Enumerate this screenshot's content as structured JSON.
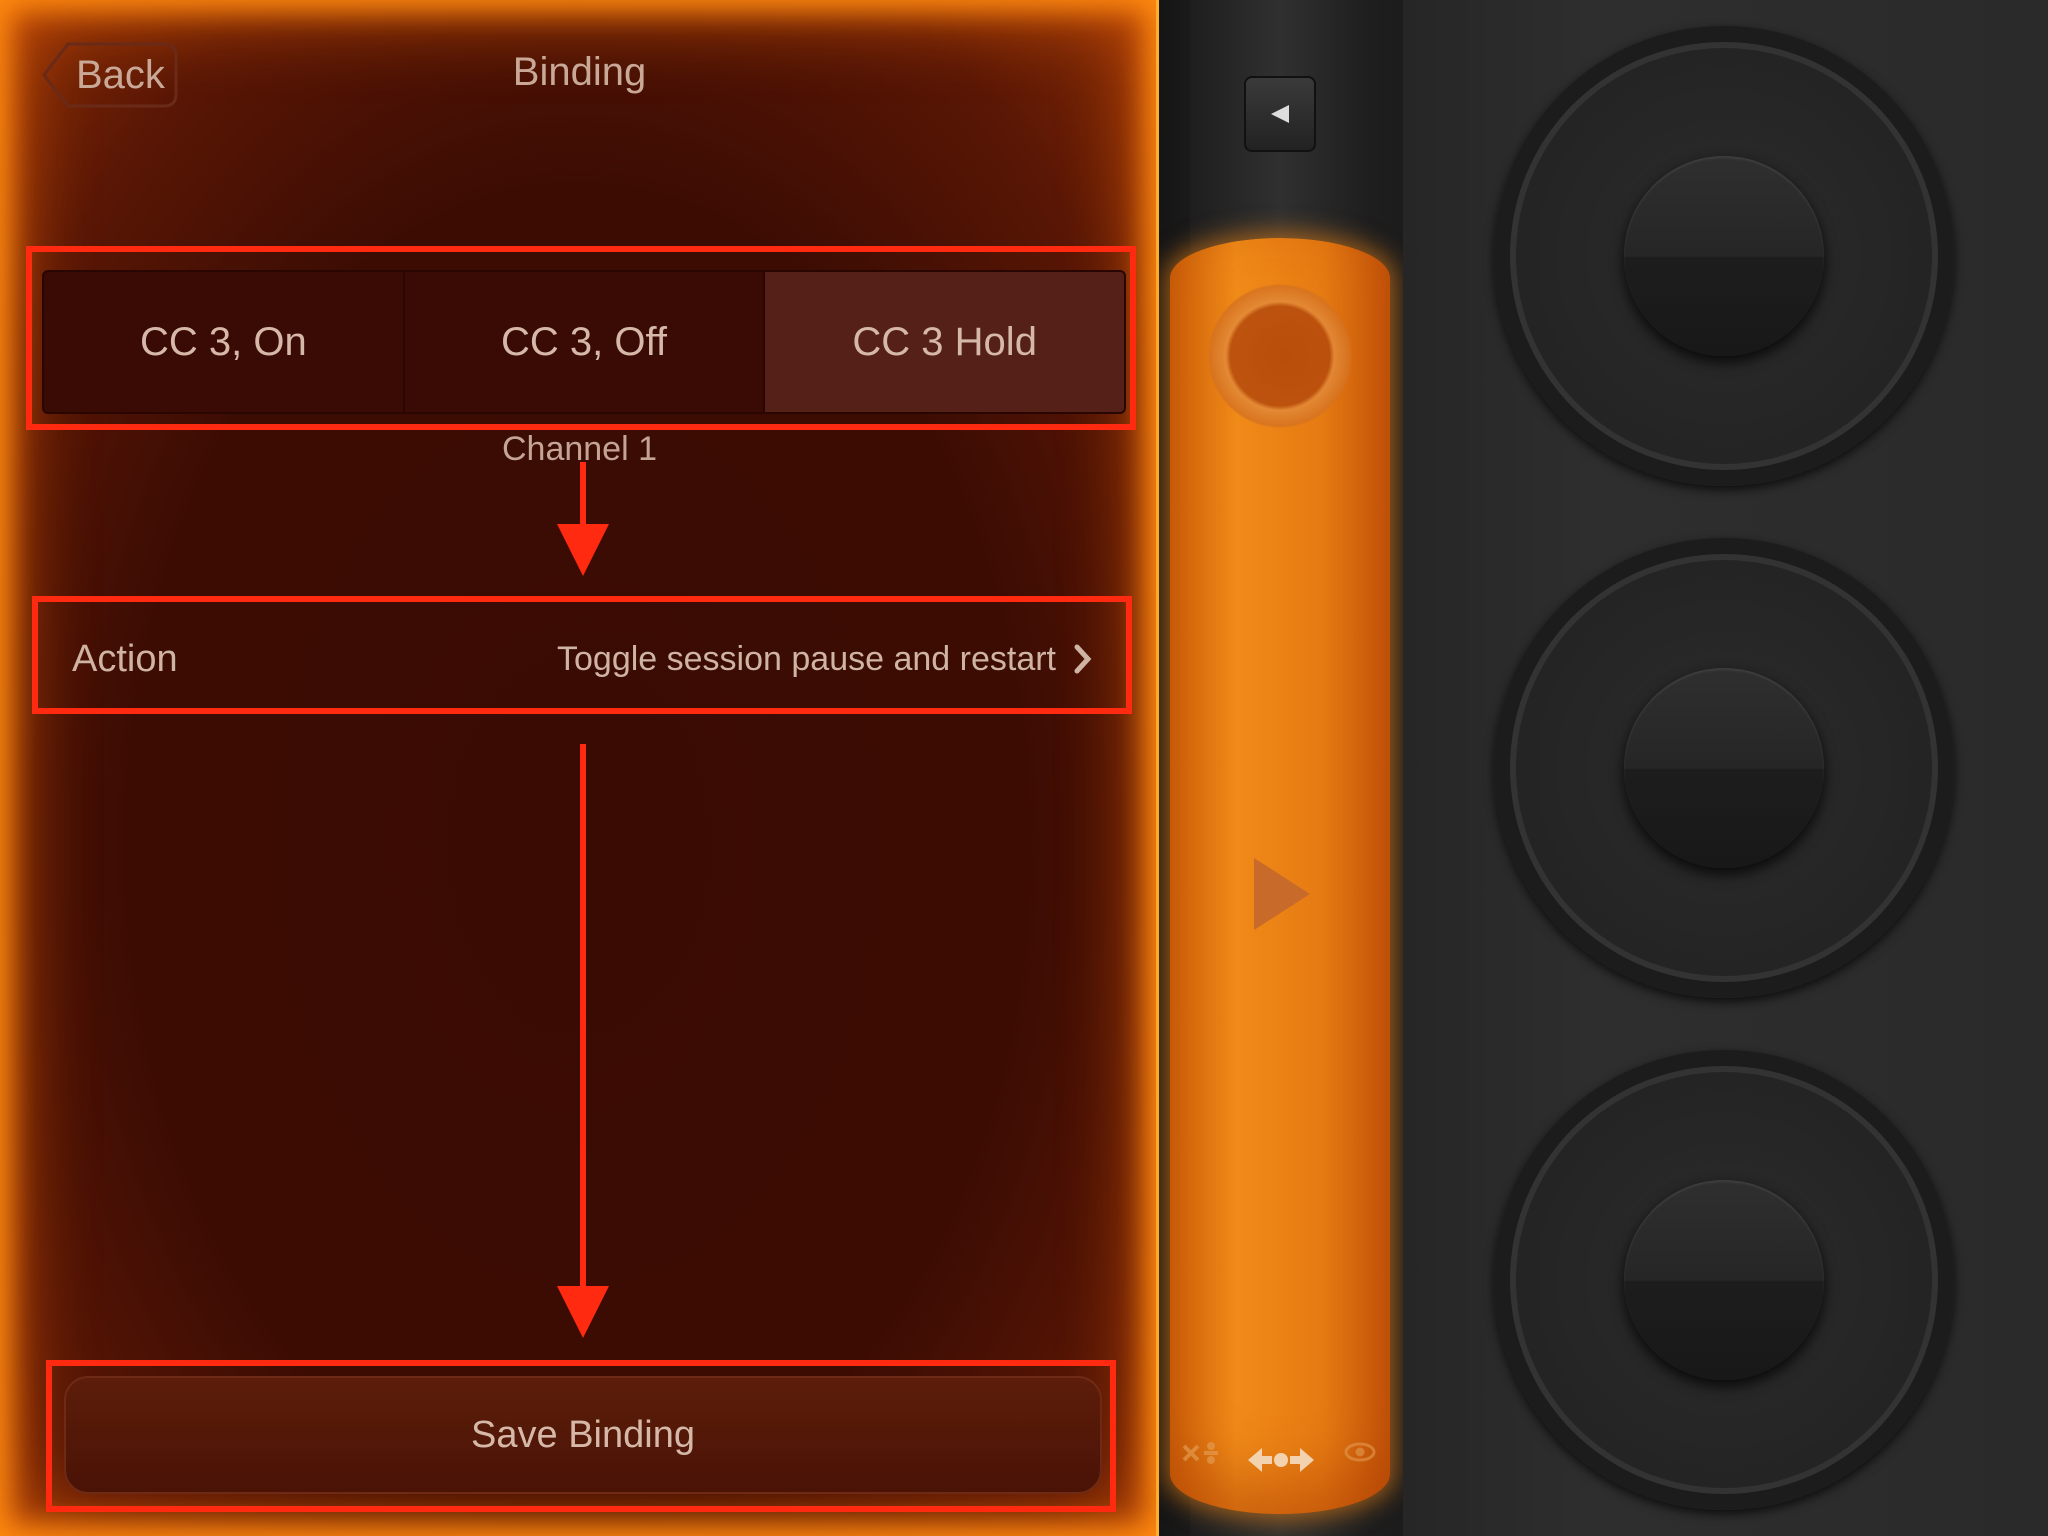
{
  "header": {
    "back_label": "Back",
    "title": "Binding"
  },
  "segments": [
    {
      "label": "CC 3, On",
      "selected": false
    },
    {
      "label": "CC 3, Off",
      "selected": false
    },
    {
      "label": "CC 3 Hold",
      "selected": true
    }
  ],
  "channel_label": "Channel 1",
  "action": {
    "label": "Action",
    "value": "Toggle session pause and restart"
  },
  "save_label": "Save Binding",
  "colors": {
    "accent_orange": "#f08a18",
    "highlight_red": "#ff2a10",
    "panel_bg": "#3c0c03"
  },
  "icons": {
    "back": "back-chevron",
    "collapse": "triangle-left",
    "play": "play-triangle",
    "action_chevron": "chevron-right"
  }
}
